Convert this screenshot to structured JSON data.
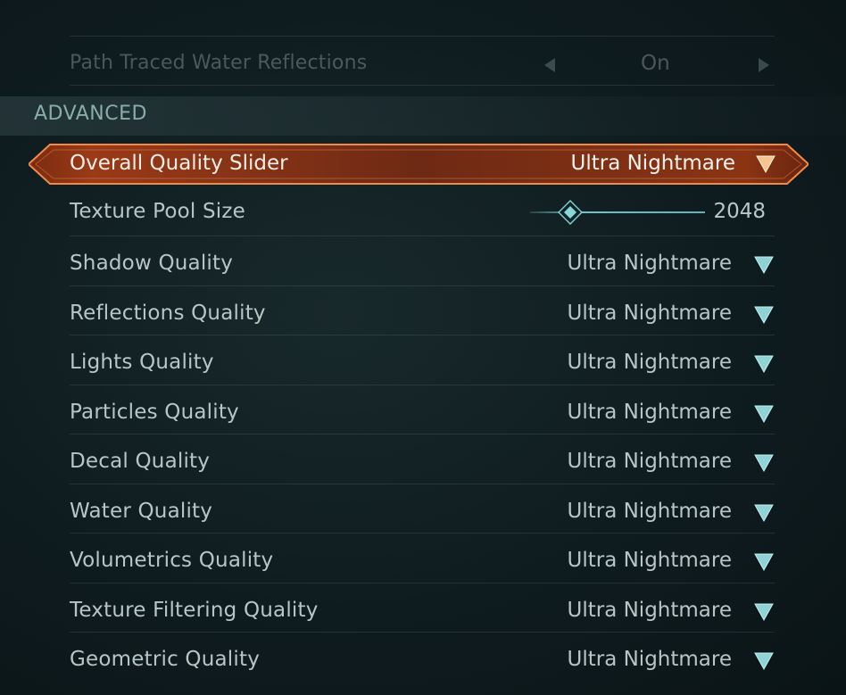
{
  "top_row": {
    "label": "Path Traced Water Reflections",
    "value": "On"
  },
  "section": {
    "title": "ADVANCED"
  },
  "selected_row": {
    "label": "Overall Quality Slider",
    "value": "Ultra Nightmare"
  },
  "texture_pool": {
    "label": "Texture Pool Size",
    "value": "2048",
    "slider_fraction": 0.16
  },
  "rows": [
    {
      "label": "Shadow Quality",
      "value": "Ultra Nightmare"
    },
    {
      "label": "Reflections Quality",
      "value": "Ultra Nightmare"
    },
    {
      "label": "Lights Quality",
      "value": "Ultra Nightmare"
    },
    {
      "label": "Particles Quality",
      "value": "Ultra Nightmare"
    },
    {
      "label": "Decal Quality",
      "value": "Ultra Nightmare"
    },
    {
      "label": "Water Quality",
      "value": "Ultra Nightmare"
    },
    {
      "label": "Volumetrics Quality",
      "value": "Ultra Nightmare"
    },
    {
      "label": "Texture Filtering Quality",
      "value": "Ultra Nightmare"
    },
    {
      "label": "Geometric Quality",
      "value": "Ultra Nightmare"
    }
  ],
  "colors": {
    "accent": "#e8642a",
    "teal": "#6fc2c4",
    "text": "#b7c6c5"
  },
  "icons": {
    "dropdown": "triangle-down-icon",
    "arrow_left": "arrow-left-icon",
    "arrow_right": "arrow-right-icon",
    "slider_knob": "diamond-icon"
  }
}
